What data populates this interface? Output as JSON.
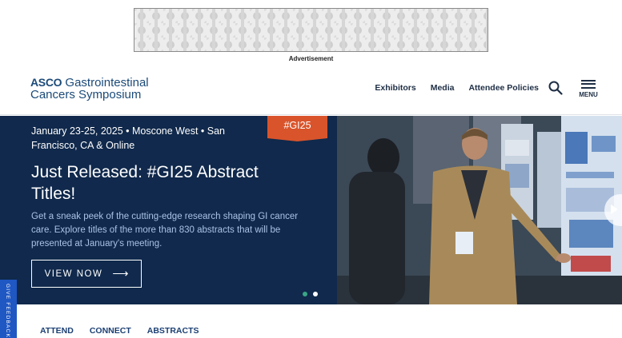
{
  "ad": {
    "label": "Advertisement"
  },
  "header": {
    "logo": {
      "brand": "ASCO",
      "line1_rest": "Gastrointestinal",
      "line2": "Cancers Symposium"
    },
    "nav": [
      "Exhibitors",
      "Media",
      "Attendee Policies"
    ],
    "search_icon": "search-icon",
    "menu_label": "MENU"
  },
  "hero": {
    "date": "January 23-25, 2025 • Moscone West • San Francisco, CA & Online",
    "hashtag": "#GI25",
    "title": "Just Released: #GI25 Abstract Titles!",
    "description": "Get a sneak peek of the cutting-edge research shaping GI cancer care. Explore titles of the more than 830 abstracts that will be presented at January's meeting.",
    "button_label": "VIEW NOW",
    "button_icon": "arrow-right-icon",
    "slides": {
      "count": 2,
      "active": 1
    }
  },
  "feedback": {
    "label": "GIVE FEEDBACK"
  },
  "bottom_nav": [
    "ATTEND",
    "CONNECT",
    "ABSTRACTS"
  ],
  "colors": {
    "hero_bg": "#10294c",
    "hashtag_flag": "#d9542b",
    "accent_green": "#3aa585",
    "feedback_bg": "#1f57c3",
    "logo_blue": "#1b4a78",
    "nav_text": "#1e2e44"
  }
}
